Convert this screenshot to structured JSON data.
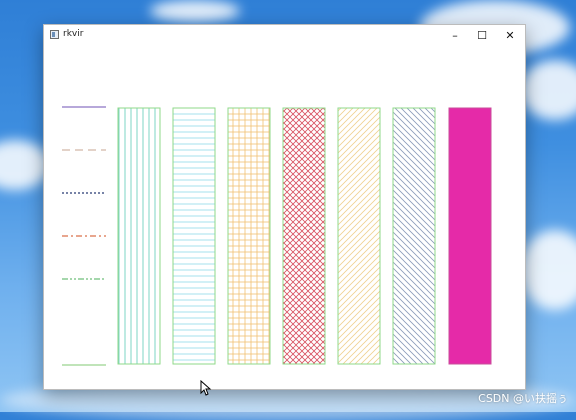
{
  "window": {
    "title": "rkvir",
    "minimize_glyph": "–",
    "maximize_glyph": "☐",
    "close_glyph": "✕"
  },
  "line_samples": [
    {
      "style": "solid",
      "color": "#8c74c4"
    },
    {
      "style": "dash",
      "color": "#d2b8a8"
    },
    {
      "style": "dot",
      "color": "#4a5a8a"
    },
    {
      "style": "dashdot",
      "color": "#d9704a"
    },
    {
      "style": "dashdotdot",
      "color": "#6fbf7a"
    },
    {
      "style": "solid",
      "color": "#9ad38f"
    }
  ],
  "hatch_bars": [
    {
      "pattern": "vertical",
      "color": "#5cc9b8",
      "border": "#8fd98a"
    },
    {
      "pattern": "horizontal",
      "color": "#8ed8ea",
      "border": "#8fd98a"
    },
    {
      "pattern": "cross",
      "color": "#f0c070",
      "border": "#8fd98a"
    },
    {
      "pattern": "diagcross",
      "color": "#d85060",
      "border": "#8fd98a"
    },
    {
      "pattern": "bdiagonal",
      "color": "#f0d090",
      "border": "#8fd98a"
    },
    {
      "pattern": "fdiagonal",
      "color": "#8a9ab8",
      "border": "#8fd98a"
    },
    {
      "pattern": "solid",
      "color": "#e52aa8",
      "border": "#8fd98a"
    }
  ],
  "desktop": {
    "watermark": "CSDN @い扶摇ぅ"
  }
}
